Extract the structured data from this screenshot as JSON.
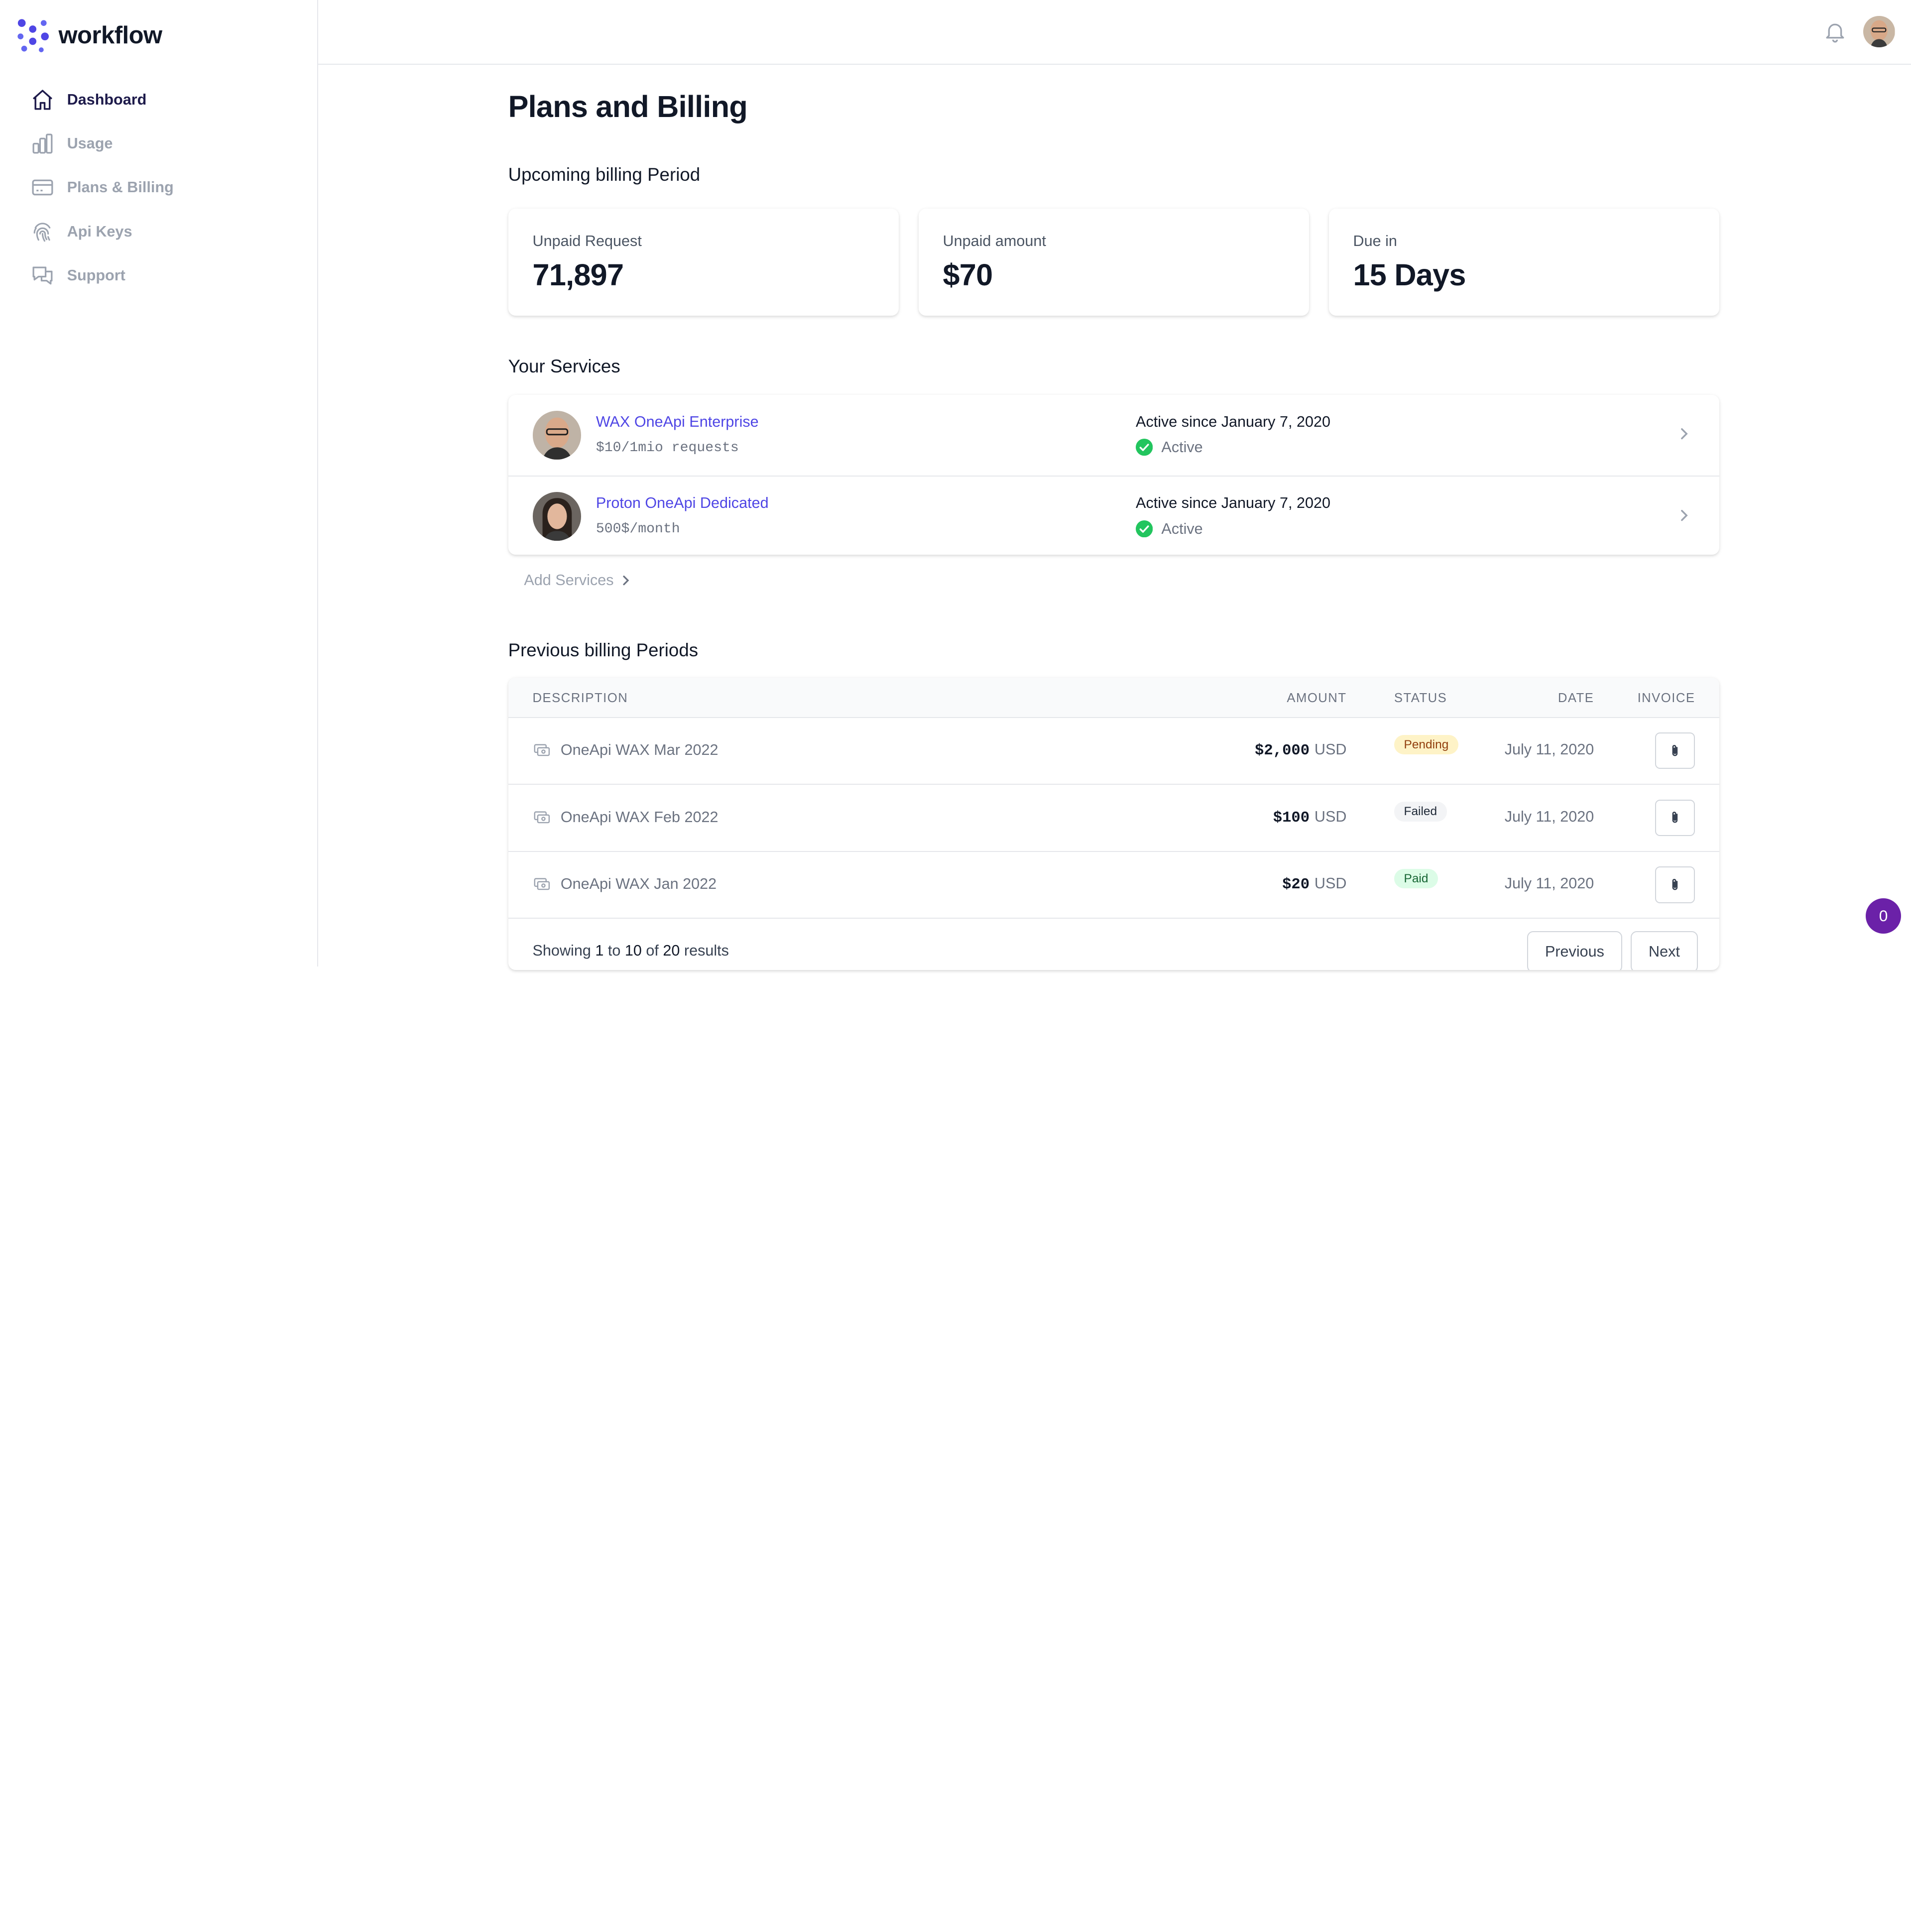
{
  "app": {
    "name": "workflow",
    "accent": "#4f46e5"
  },
  "sidebar": {
    "items": [
      {
        "label": "Dashboard",
        "icon": "home-icon",
        "active": true
      },
      {
        "label": "Usage",
        "icon": "bar-chart-icon",
        "active": false
      },
      {
        "label": "Plans & Billing",
        "icon": "credit-card-icon",
        "active": false
      },
      {
        "label": "Api Keys",
        "icon": "fingerprint-icon",
        "active": false
      },
      {
        "label": "Support",
        "icon": "chat-bubbles-icon",
        "active": false
      }
    ]
  },
  "header": {
    "notification_icon": "bell-icon",
    "avatar": "user-avatar"
  },
  "page": {
    "title": "Plans and Billing",
    "upcoming_title": "Upcoming billing Period",
    "services_title": "Your Services",
    "previous_title": "Previous billing Periods"
  },
  "stats": [
    {
      "label": "Unpaid Request",
      "value": "71,897"
    },
    {
      "label": "Unpaid amount",
      "value": "$70"
    },
    {
      "label": "Due in",
      "value": "15 Days"
    }
  ],
  "services": [
    {
      "name": "WAX OneApi Enterprise",
      "price": "$10/1mio requests",
      "since": "Active since January 7, 2020",
      "status": "Active"
    },
    {
      "name": "Proton OneApi Dedicated",
      "price": "500$/month",
      "since": "Active since January 7, 2020",
      "status": "Active"
    }
  ],
  "add_services_label": "Add Services",
  "table": {
    "headers": {
      "description": "Description",
      "amount": "Amount",
      "status": "Status",
      "date": "Date",
      "invoice": "Invoice"
    },
    "rows": [
      {
        "description": "OneApi WAX Mar 2022",
        "amount": "$2,000",
        "currency": "USD",
        "status": "Pending",
        "date": "July 11, 2020"
      },
      {
        "description": "OneApi WAX Feb 2022",
        "amount": "$100",
        "currency": "USD",
        "status": "Failed",
        "date": "July 11, 2020"
      },
      {
        "description": "OneApi WAX Jan 2022",
        "amount": "$20",
        "currency": "USD",
        "status": "Paid",
        "date": "July 11, 2020"
      }
    ],
    "footer": {
      "showing": "Showing",
      "from": "1",
      "to_word": "to",
      "to": "10",
      "of_word": "of",
      "total": "20",
      "results": "results"
    },
    "pagination": {
      "previous": "Previous",
      "next": "Next"
    }
  },
  "chat_widget": {
    "count": "0"
  }
}
